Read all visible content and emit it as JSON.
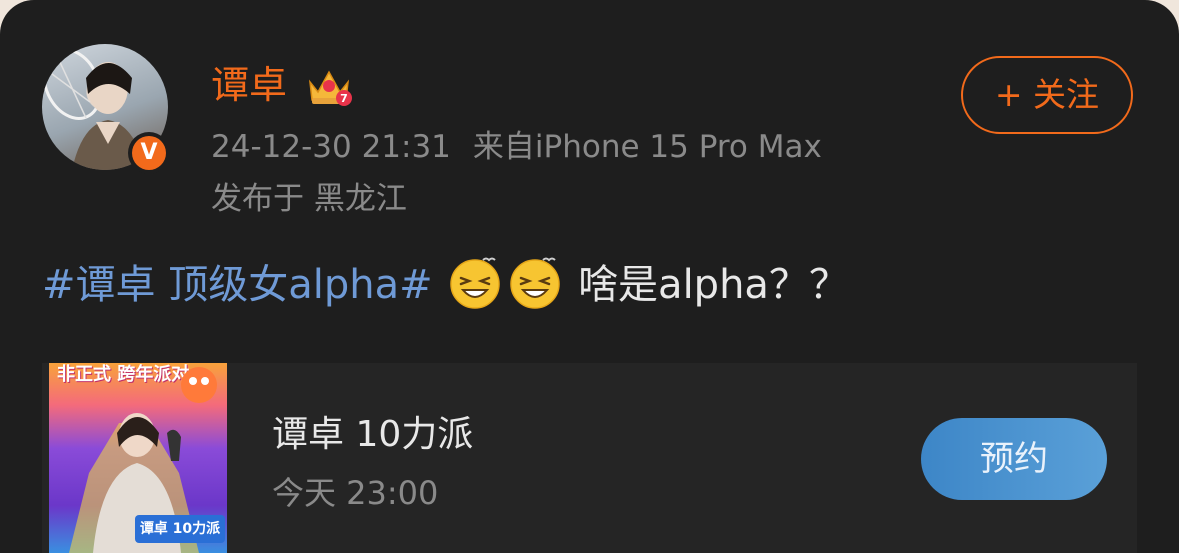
{
  "post": {
    "author": {
      "name": "谭卓",
      "verified_badge": "V",
      "crown_level": "7"
    },
    "timestamp": "24-12-30 21:31",
    "source": "来自iPhone 15 Pro Max",
    "location": "发布于 黑龙江",
    "follow_label": "+ 关注",
    "text": {
      "hashtag": "#谭卓 顶级女alpha#",
      "body": "啥是alpha？？",
      "emojis": [
        "squint-laugh-emoji",
        "squint-laugh-emoji"
      ]
    }
  },
  "live_card": {
    "poster_title": "非正式 跨年派对",
    "poster_badge": "谭卓 10力派",
    "title": "谭卓 10力派",
    "time": "今天 23:00",
    "reserve_label": "预约"
  },
  "colors": {
    "accent": "#f26a1b",
    "hashtag": "#6f9ad6",
    "background": "#1e1e1e",
    "reserve_button": "#4a93d0"
  }
}
